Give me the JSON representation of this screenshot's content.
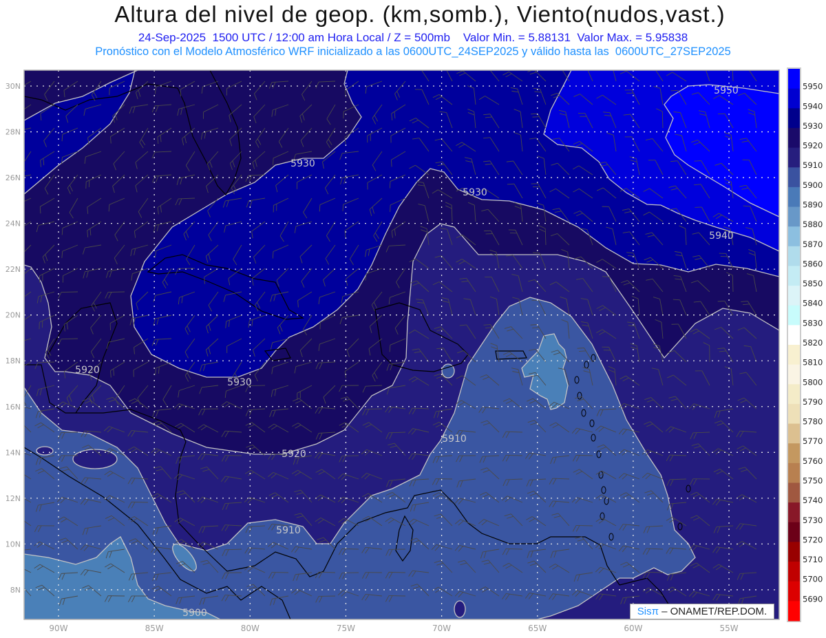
{
  "header": {
    "title": "Altura del nivel de geop. (km,somb.), Viento(nudos,vast.)",
    "subtitle": "24-Sep-2025  1500 UTC / 12:00 am Hora Local / Z = 500mb    Valor Min. = 5.88131  Valor Max. = 5.95838",
    "model_line": "Pronóstico con el Modelo Atmosférico WRF inicializado a las 0600UTC_24SEP2025 y válido hasta las  0600UTC_27SEP2025"
  },
  "map": {
    "lon_labels": [
      "90W",
      "85W",
      "80W",
      "75W",
      "70W",
      "65W",
      "60W",
      "55W"
    ],
    "lon_values": [
      -90,
      -85,
      -80,
      -75,
      -70,
      -65,
      -60,
      -55
    ],
    "lat_labels": [
      "30N",
      "28N",
      "26N",
      "24N",
      "22N",
      "20N",
      "18N",
      "16N",
      "14N",
      "12N",
      "10N",
      "8N"
    ],
    "lat_values": [
      30,
      28,
      26,
      24,
      22,
      20,
      18,
      16,
      14,
      12,
      10,
      8
    ],
    "contour_labels": [
      "5930",
      "5930",
      "5950",
      "5940",
      "5920",
      "5930",
      "5910",
      "5920",
      "5910",
      "5900"
    ],
    "band_colors": {
      "b5950": "#0000ff",
      "b5940": "#0000dc",
      "b5930": "#00009c",
      "b5920": "#170a62",
      "b5910": "#241c7e",
      "b5900": "#3a56a2",
      "b5890": "#4a80b8"
    }
  },
  "colorbar": {
    "colors": [
      "#0000ff",
      "#0000d0",
      "#00008c",
      "#1a0a6a",
      "#261e7e",
      "#3a52a0",
      "#4a7ab8",
      "#6898c8",
      "#8cbfe0",
      "#b0dcec",
      "#c4ecf4",
      "#dcf4f8",
      "#c8fcfc",
      "#ffffff",
      "#f8f0d0",
      "#faf4e4",
      "#f4ecc8",
      "#eee0b8",
      "#dcc090",
      "#c49860",
      "#b88050",
      "#a05840",
      "#881828",
      "#6c0018",
      "#980000",
      "#c00000",
      "#dc0000",
      "#ff0000"
    ],
    "labels": [
      "5950",
      "5940",
      "5930",
      "5920",
      "5910",
      "5900",
      "5890",
      "5880",
      "5870",
      "5860",
      "5850",
      "5840",
      "5830",
      "5820",
      "5810",
      "5800",
      "5790",
      "5780",
      "5770",
      "5760",
      "5750",
      "5740",
      "5730",
      "5720",
      "5710",
      "5700",
      "5690"
    ]
  },
  "credit": {
    "brand": "Sisπ",
    "text": " – ONAMET/REP.DOM."
  }
}
